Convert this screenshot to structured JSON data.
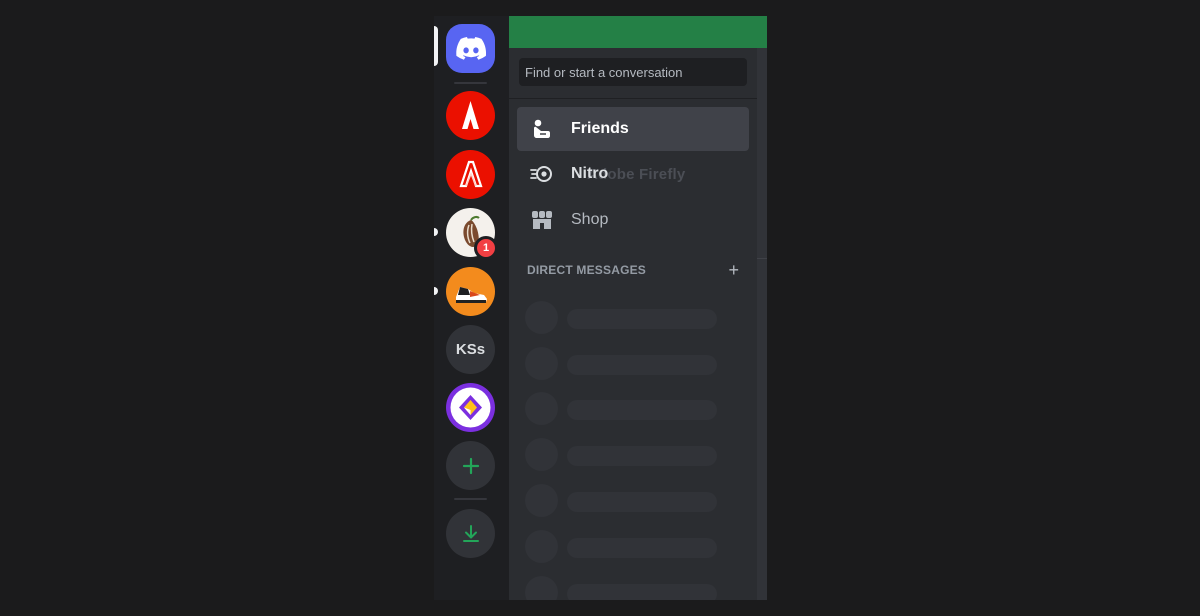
{
  "rail": {
    "servers": [
      {
        "name": "home-discord",
        "icon": "discord-logo-icon",
        "color": "#5865f2"
      },
      {
        "name": "adobe-server",
        "icon": "adobe-logo-icon",
        "color": "#eb1000"
      },
      {
        "name": "adobe-firefly-server",
        "icon": "adobe-firefly-icon",
        "color": "#eb1000"
      },
      {
        "name": "pepper-server",
        "icon": "pepper-logo-icon",
        "badge": "1"
      },
      {
        "name": "sneaker-server",
        "icon": "sneaker-icon",
        "color": "#f38b1d"
      },
      {
        "name": "kss-server",
        "label": "KSs"
      },
      {
        "name": "purple-server",
        "icon": "purple-logo-icon",
        "color": "#7b2fe0"
      }
    ],
    "add_server_icon": "plus-icon",
    "download_icon": "download-icon"
  },
  "sidebar": {
    "search_placeholder": "Find or start a conversation",
    "nav": [
      {
        "label": "Friends",
        "icon": "friends-icon",
        "active": true
      },
      {
        "label": "Nitro",
        "icon": "nitro-icon"
      },
      {
        "label": "Shop",
        "icon": "shop-icon"
      }
    ],
    "ghost_text": "Adobe Firefly",
    "dm_header": "DIRECT MESSAGES",
    "dm_add": "+"
  },
  "colors": {
    "accent_green": "#248046",
    "blurple": "#5865f2",
    "badge_red": "#f23f43"
  }
}
